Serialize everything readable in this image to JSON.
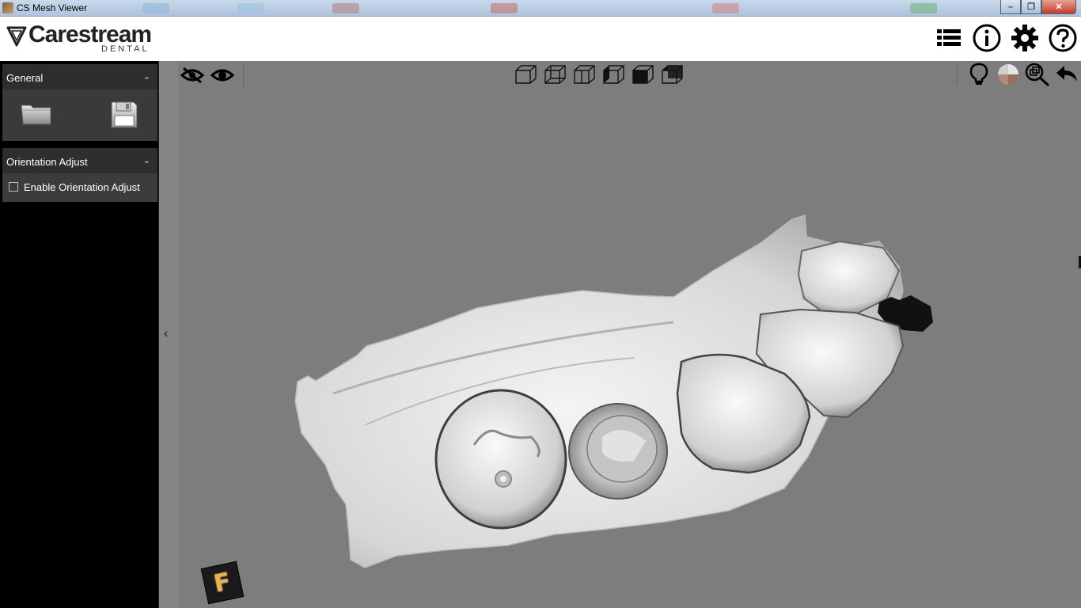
{
  "window": {
    "title": "CS Mesh Viewer"
  },
  "header": {
    "brand": "Carestream",
    "brand_sub": "DENTAL",
    "icons": [
      "list-icon",
      "info-icon",
      "settings-gear-icon",
      "help-icon"
    ]
  },
  "sidebar": {
    "general": {
      "label": "General",
      "buttons": [
        "open-folder-icon",
        "save-floppy-icon"
      ]
    },
    "orientation": {
      "label": "Orientation Adjust",
      "checkbox_label": "Enable Orientation Adjust",
      "checked": false
    }
  },
  "viewport": {
    "left_tools": [
      "hide-eye-icon",
      "show-eye-icon"
    ],
    "view_tools": [
      "view-cube-front-icon",
      "view-cube-back-icon",
      "view-cube-right-icon",
      "view-cube-left-icon",
      "view-cube-bottom-icon",
      "view-cube-top-icon"
    ],
    "right_tools": [
      "lighting-bulb-icon",
      "texture-color-icon",
      "zoom-fit-icon",
      "undo-arrow-icon"
    ],
    "orientation_badge": "F",
    "colors": {
      "background": "#7d7d7d",
      "mesh": "#d9d9d9"
    }
  }
}
